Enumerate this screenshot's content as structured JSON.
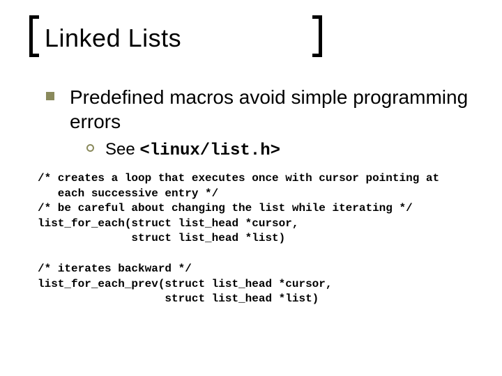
{
  "title": "Linked Lists",
  "bullet1": "Predefined macros avoid simple programming errors",
  "sub1_prefix": "See ",
  "sub1_code": "<linux/list.h>",
  "code_lines": {
    "c1": "/* creates a loop that executes once with cursor pointing at",
    "c2": "   each successive entry */",
    "c3": "/* be careful about changing the list while iterating */",
    "c4": "list_for_each(struct list_head *cursor,",
    "c5": "              struct list_head *list)",
    "c6": "/* iterates backward */",
    "c7": "list_for_each_prev(struct list_head *cursor,",
    "c8": "                   struct list_head *list)"
  }
}
